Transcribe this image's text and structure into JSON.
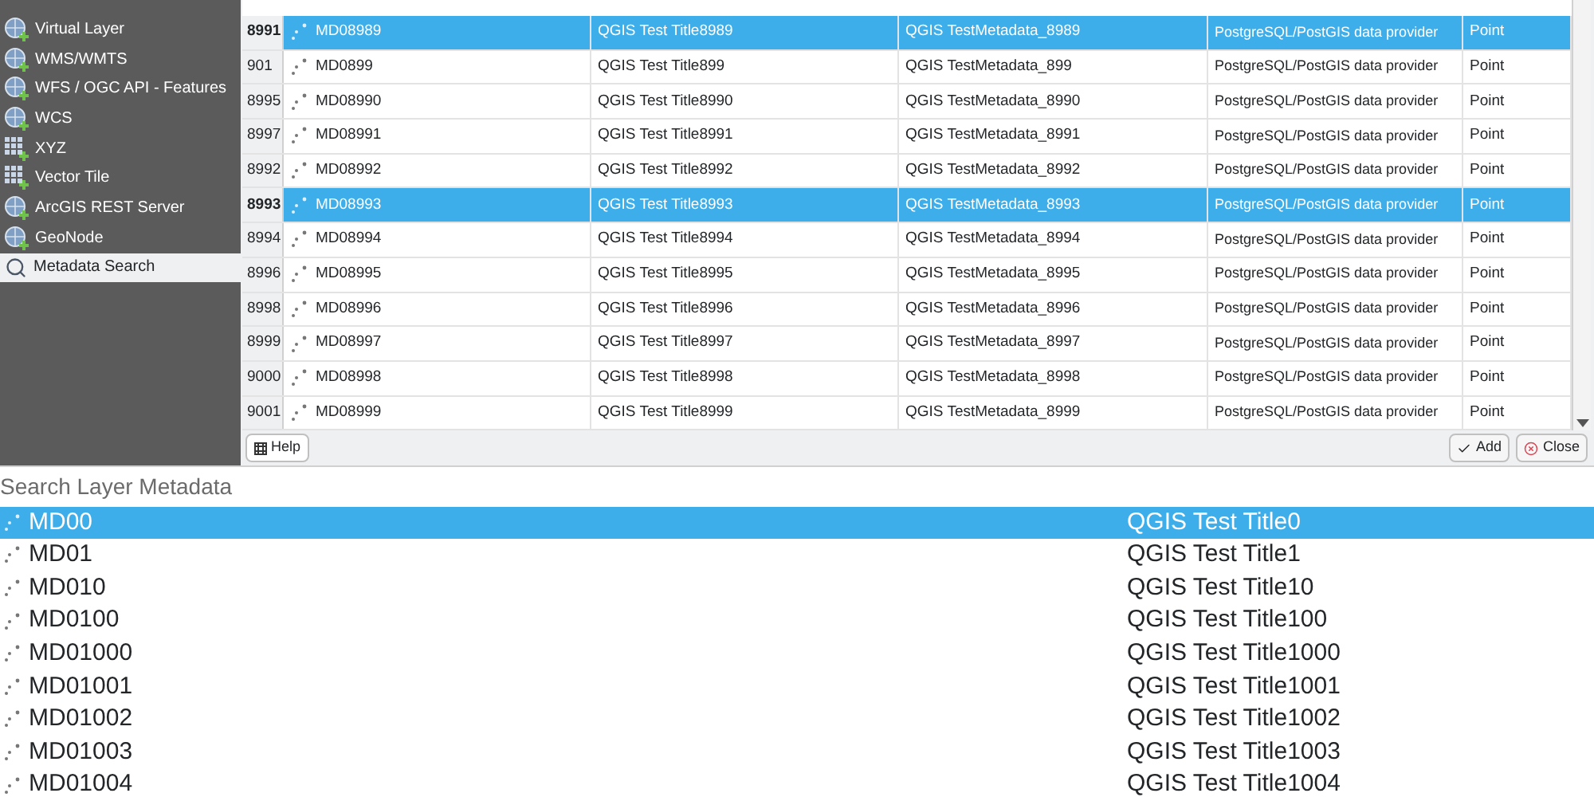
{
  "sidebar": {
    "items": [
      {
        "label": "Virtual Layer",
        "kind": "provider",
        "selected": false
      },
      {
        "label": "WMS/WMTS",
        "kind": "provider",
        "selected": false
      },
      {
        "label": "WFS / OGC API - Features",
        "kind": "provider",
        "selected": false
      },
      {
        "label": "WCS",
        "kind": "provider",
        "selected": false
      },
      {
        "label": "XYZ",
        "kind": "grid",
        "selected": false
      },
      {
        "label": "Vector Tile",
        "kind": "grid",
        "selected": false
      },
      {
        "label": "ArcGIS REST Server",
        "kind": "provider",
        "selected": false
      },
      {
        "label": "GeoNode",
        "kind": "provider",
        "selected": false
      },
      {
        "label": "Metadata Search",
        "kind": "search",
        "selected": true
      }
    ]
  },
  "table": {
    "rows": [
      {
        "header": "8991",
        "id": "MD08989",
        "title": "QGIS Test Title8989",
        "metadata": "QGIS TestMetadata_8989",
        "provider": "PostgreSQL/PostGIS data provider",
        "geometry": "Point",
        "selected": true
      },
      {
        "header": "901",
        "id": "MD0899",
        "title": "QGIS Test Title899",
        "metadata": "QGIS TestMetadata_899",
        "provider": "PostgreSQL/PostGIS data provider",
        "geometry": "Point",
        "selected": false
      },
      {
        "header": "8995",
        "id": "MD08990",
        "title": "QGIS Test Title8990",
        "metadata": "QGIS TestMetadata_8990",
        "provider": "PostgreSQL/PostGIS data provider",
        "geometry": "Point",
        "selected": false
      },
      {
        "header": "8997",
        "id": "MD08991",
        "title": "QGIS Test Title8991",
        "metadata": "QGIS TestMetadata_8991",
        "provider": "PostgreSQL/PostGIS data provider",
        "geometry": "Point",
        "selected": false
      },
      {
        "header": "8992",
        "id": "MD08992",
        "title": "QGIS Test Title8992",
        "metadata": "QGIS TestMetadata_8992",
        "provider": "PostgreSQL/PostGIS data provider",
        "geometry": "Point",
        "selected": false
      },
      {
        "header": "8993",
        "id": "MD08993",
        "title": "QGIS Test Title8993",
        "metadata": "QGIS TestMetadata_8993",
        "provider": "PostgreSQL/PostGIS data provider",
        "geometry": "Point",
        "selected": true
      },
      {
        "header": "8994",
        "id": "MD08994",
        "title": "QGIS Test Title8994",
        "metadata": "QGIS TestMetadata_8994",
        "provider": "PostgreSQL/PostGIS data provider",
        "geometry": "Point",
        "selected": false
      },
      {
        "header": "8996",
        "id": "MD08995",
        "title": "QGIS Test Title8995",
        "metadata": "QGIS TestMetadata_8995",
        "provider": "PostgreSQL/PostGIS data provider",
        "geometry": "Point",
        "selected": false
      },
      {
        "header": "8998",
        "id": "MD08996",
        "title": "QGIS Test Title8996",
        "metadata": "QGIS TestMetadata_8996",
        "provider": "PostgreSQL/PostGIS data provider",
        "geometry": "Point",
        "selected": false
      },
      {
        "header": "8999",
        "id": "MD08997",
        "title": "QGIS Test Title8997",
        "metadata": "QGIS TestMetadata_8997",
        "provider": "PostgreSQL/PostGIS data provider",
        "geometry": "Point",
        "selected": false
      },
      {
        "header": "9000",
        "id": "MD08998",
        "title": "QGIS Test Title8998",
        "metadata": "QGIS TestMetadata_8998",
        "provider": "PostgreSQL/PostGIS data provider",
        "geometry": "Point",
        "selected": false
      },
      {
        "header": "9001",
        "id": "MD08999",
        "title": "QGIS Test Title8999",
        "metadata": "QGIS TestMetadata_8999",
        "provider": "PostgreSQL/PostGIS data provider",
        "geometry": "Point",
        "selected": false
      }
    ]
  },
  "buttons": {
    "help": "Help",
    "add": "Add",
    "close": "Close"
  },
  "search": {
    "placeholder": "Search Layer Metadata"
  },
  "results": [
    {
      "id": "MD00",
      "title": "QGIS Test Title0",
      "selected": true
    },
    {
      "id": "MD01",
      "title": "QGIS Test Title1",
      "selected": false
    },
    {
      "id": "MD010",
      "title": "QGIS Test Title10",
      "selected": false
    },
    {
      "id": "MD0100",
      "title": "QGIS Test Title100",
      "selected": false
    },
    {
      "id": "MD01000",
      "title": "QGIS Test Title1000",
      "selected": false
    },
    {
      "id": "MD01001",
      "title": "QGIS Test Title1001",
      "selected": false
    },
    {
      "id": "MD01002",
      "title": "QGIS Test Title1002",
      "selected": false
    },
    {
      "id": "MD01003",
      "title": "QGIS Test Title1003",
      "selected": false
    },
    {
      "id": "MD01004",
      "title": "QGIS Test Title1004",
      "selected": false
    }
  ]
}
